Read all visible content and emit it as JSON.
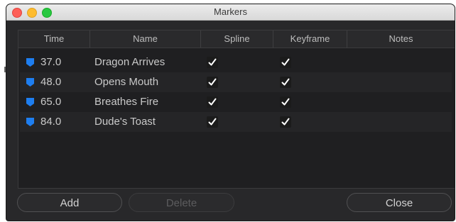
{
  "window": {
    "title": "Markers"
  },
  "columns": [
    "Time",
    "Name",
    "Spline",
    "Keyframe",
    "Notes"
  ],
  "rows": [
    {
      "time": "37.0",
      "name": "Dragon Arrives",
      "spline": true,
      "keyframe": true
    },
    {
      "time": "48.0",
      "name": "Opens Mouth",
      "spline": true,
      "keyframe": true
    },
    {
      "time": "65.0",
      "name": "Breathes Fire",
      "spline": true,
      "keyframe": true
    },
    {
      "time": "84.0",
      "name": "Dude's Toast",
      "spline": true,
      "keyframe": true
    }
  ],
  "buttons": {
    "add": "Add",
    "delete": "Delete",
    "close": "Close"
  },
  "colors": {
    "marker": "#1e7ef0",
    "window_bg": "#28282a"
  }
}
